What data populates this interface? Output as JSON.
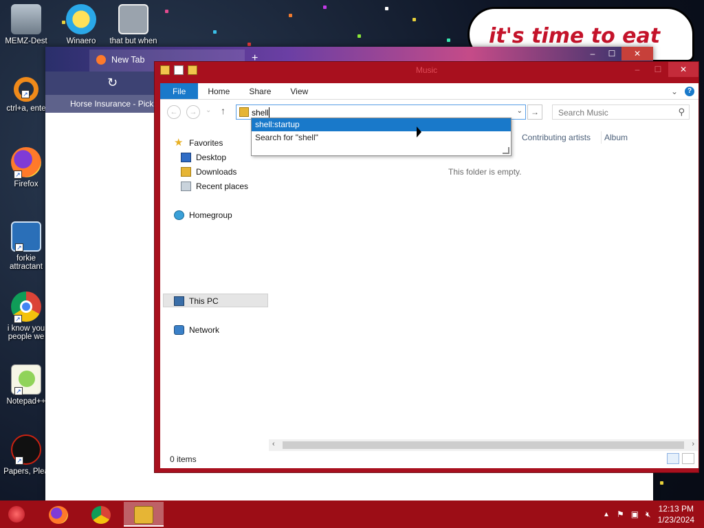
{
  "desktop": {
    "icons": [
      {
        "label": "MEMZ-Dest"
      },
      {
        "label": "ctrl+a, ente"
      },
      {
        "label": "Firefox"
      },
      {
        "label": "forkie attractant"
      },
      {
        "label": "i know you people we"
      },
      {
        "label": "Notepad++"
      },
      {
        "label": "Papers, Plea"
      }
    ],
    "top_icons": [
      {
        "label": "Winaero"
      },
      {
        "label": "that but when"
      }
    ],
    "meme_text": "it's time to eat shit"
  },
  "browser": {
    "tab_title": "New Tab",
    "bookmark": "Horse Insurance - Pick...",
    "new_tab": "+",
    "controls": {
      "minimize": "–",
      "maximize": "☐",
      "close": "✕"
    }
  },
  "explorer": {
    "title": "Music",
    "controls": {
      "minimize": "–",
      "maximize": "☐",
      "close": "✕"
    },
    "ribbon": {
      "file": "File",
      "tabs": [
        "Home",
        "Share",
        "View"
      ],
      "help": "?",
      "expand": "⌄"
    },
    "nav_buttons": {
      "back": "←",
      "forward": "→",
      "recent": "⌄",
      "up": "↑"
    },
    "address": {
      "value": "shell",
      "dropdown": "⌄",
      "go": "→"
    },
    "search": {
      "placeholder": "Search Music",
      "icon": "⚲"
    },
    "suggestions": [
      "shell:startup",
      "Search for \"shell\""
    ],
    "navpane": {
      "favorites": "Favorites",
      "desktop": "Desktop",
      "downloads": "Downloads",
      "recent": "Recent places",
      "homegroup": "Homegroup",
      "thispc": "This PC",
      "network": "Network"
    },
    "columns": [
      "Contributing artists",
      "Album"
    ],
    "empty_message": "This folder is empty.",
    "status": "0 items",
    "scroll": {
      "left": "‹",
      "right": "›"
    }
  },
  "taskbar": {
    "time": "12:13 PM",
    "date": "1/23/2024",
    "tray_chevron": "▲",
    "apps": [
      "Firefox",
      "Chrome",
      "File Explorer"
    ]
  },
  "colors": {
    "window_accent": "#a8101e",
    "taskbar": "#9c0d16",
    "selection_blue": "#1979ca"
  }
}
